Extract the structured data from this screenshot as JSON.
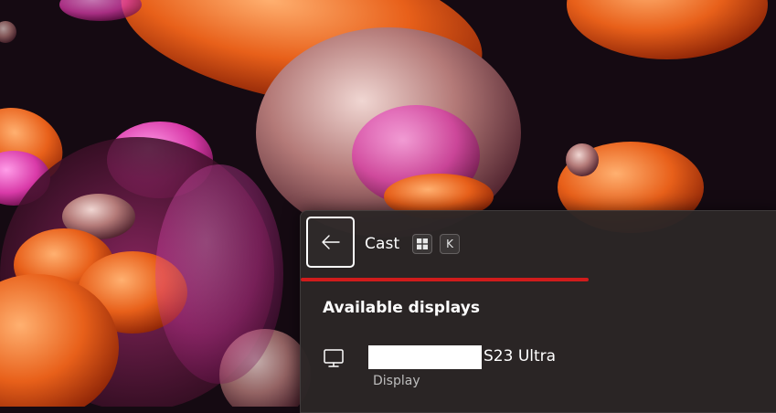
{
  "panel": {
    "title": "Cast",
    "shortcut_keys": [
      "win-key",
      "K"
    ],
    "progress": 0.6,
    "section_title": "Available displays",
    "devices": [
      {
        "name": "S23 Ultra",
        "type": "Display",
        "icon": "monitor-icon"
      }
    ]
  },
  "colors": {
    "panel_bg": "#2c2626",
    "accent_progress": "#d01c1c",
    "wallpaper_bg": "#150a12"
  }
}
